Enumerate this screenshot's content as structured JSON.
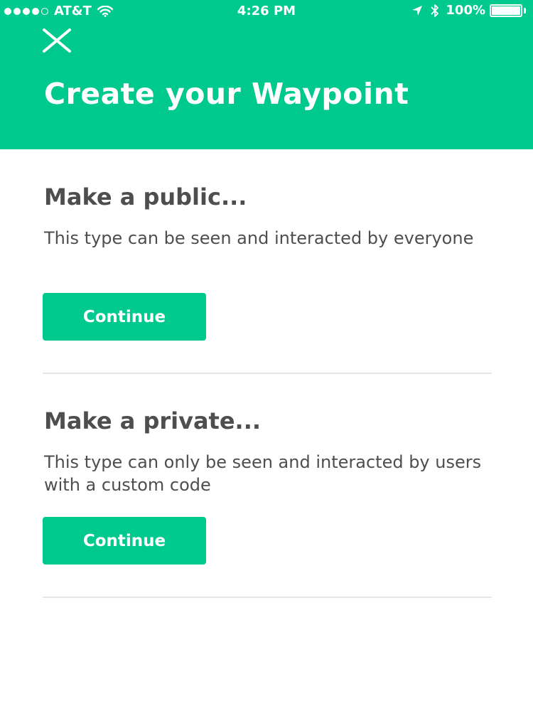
{
  "status_bar": {
    "carrier": "AT&T",
    "time": "4:26 PM",
    "battery": "100%",
    "battery_level": 1.0,
    "signal_bars_filled": 4,
    "signal_bars_total": 5
  },
  "header": {
    "title": "Create your Waypoint",
    "close_icon": "close-icon",
    "background_color": "#00c98d"
  },
  "options": [
    {
      "title": "Make a public...",
      "description": "This type can be seen and interacted by everyone",
      "button_label": "Continue"
    },
    {
      "title": "Make a private...",
      "description": "This type can only be seen and interacted by users with a custom code",
      "button_label": "Continue"
    }
  ],
  "colors": {
    "accent": "#00c98d",
    "text": "#4e4e50",
    "divider": "#e6e6e6"
  }
}
